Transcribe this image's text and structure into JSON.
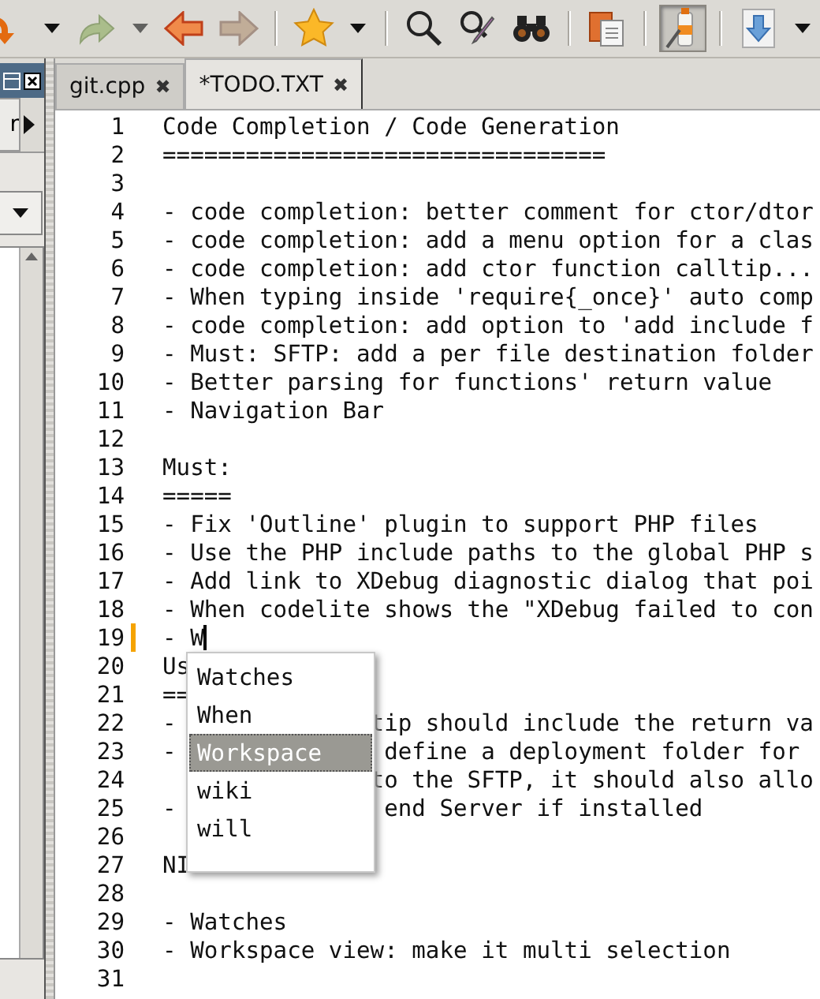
{
  "toolbar": [
    {
      "kind": "redo",
      "disabled": false
    },
    {
      "kind": "menu",
      "disabled": false
    },
    {
      "kind": "forward-green",
      "disabled": true
    },
    {
      "kind": "menu",
      "disabled": true
    },
    {
      "kind": "back",
      "disabled": false
    },
    {
      "kind": "forward",
      "disabled": true
    },
    {
      "kind": "separator"
    },
    {
      "kind": "bookmark",
      "disabled": false
    },
    {
      "kind": "menu",
      "disabled": false
    },
    {
      "kind": "separator"
    },
    {
      "kind": "find",
      "disabled": false
    },
    {
      "kind": "replace",
      "disabled": false
    },
    {
      "kind": "find-files",
      "disabled": false
    },
    {
      "kind": "separator"
    },
    {
      "kind": "pages",
      "disabled": false
    },
    {
      "kind": "separator"
    },
    {
      "kind": "highlight",
      "disabled": false,
      "pressed": true
    },
    {
      "kind": "separator"
    },
    {
      "kind": "download",
      "disabled": false
    },
    {
      "kind": "menu",
      "disabled": false
    }
  ],
  "left_panel": {
    "tab": "r"
  },
  "tabs": [
    {
      "label": "git.cpp",
      "selected": false
    },
    {
      "label": "*TODO.TXT",
      "selected": true
    }
  ],
  "close_glyph": "✖",
  "editor": {
    "lines": [
      {
        "number": "1",
        "text": "Code Completion / Code Generation"
      },
      {
        "number": "2",
        "text": "================================"
      },
      {
        "number": "3"
      },
      {
        "number": "4",
        "text": "- code completion: better comment for ctor/dtor"
      },
      {
        "number": "5",
        "text": "- code completion: add a menu option for a clas"
      },
      {
        "number": "6",
        "text": "- code completion: add ctor function calltip..."
      },
      {
        "number": "7",
        "text": "- When typing inside 'require{_once}' auto comp"
      },
      {
        "number": "8",
        "text": "- code completion: add option to 'add include f"
      },
      {
        "number": "9",
        "text": "- Must: SFTP: add a per file destination folder"
      },
      {
        "number": "10",
        "text": "- Better parsing for functions' return value"
      },
      {
        "number": "11",
        "text": "- Navigation Bar"
      },
      {
        "number": "12"
      },
      {
        "number": "13",
        "text": "Must:"
      },
      {
        "number": "14",
        "text": "====="
      },
      {
        "number": "15",
        "text": "- Fix 'Outline' plugin to support PHP files"
      },
      {
        "number": "16",
        "text": "- Use the PHP include paths to the global PHP s"
      },
      {
        "number": "17",
        "text": "- Add link to XDebug diagnostic dialog that poi"
      },
      {
        "number": "18",
        "text": "- When codelite shows the \"XDebug failed to con"
      },
      {
        "number": "19",
        "text": "- W",
        "modified": true,
        "caret": true
      },
      {
        "number": "20",
        "text": "Us"
      },
      {
        "number": "21",
        "text": "=="
      },
      {
        "number": "22",
        "text": "-",
        "rest": "tip should include the return va"
      },
      {
        "number": "23",
        "text": "-",
        "rest": " define a deployment folder for"
      },
      {
        "number": "24",
        "rest": "to the SFTP, it should also allo"
      },
      {
        "number": "25",
        "text": "-",
        "rest": " end Server if installed"
      },
      {
        "number": "26"
      },
      {
        "number": "27",
        "text": "NI"
      },
      {
        "number": "28"
      },
      {
        "number": "29",
        "text": "- Watches"
      },
      {
        "number": "30",
        "text": "- Workspace view: make it multi selection"
      },
      {
        "number": "31"
      }
    ]
  },
  "completion": [
    {
      "label": "Watches",
      "selected": false
    },
    {
      "label": "When",
      "selected": false
    },
    {
      "label": "Workspace",
      "selected": true
    },
    {
      "label": "wiki",
      "selected": false
    },
    {
      "label": "will",
      "selected": false
    }
  ]
}
